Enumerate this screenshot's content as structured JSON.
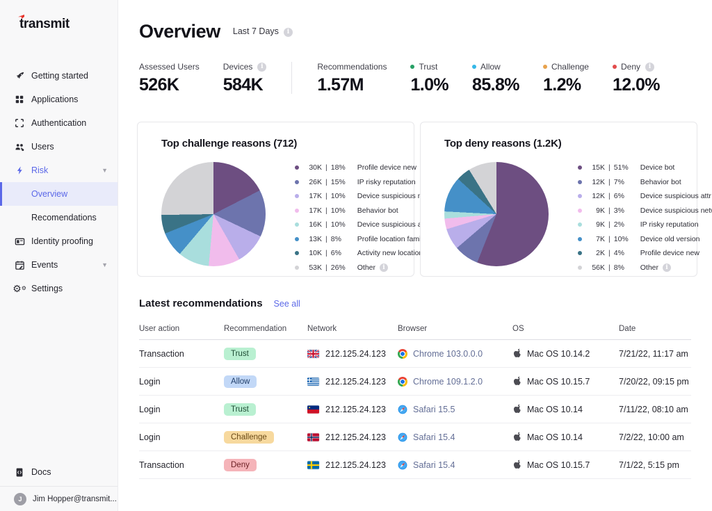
{
  "app": {
    "logo_text": "transmit"
  },
  "sidebar": {
    "items": [
      {
        "label": "Getting started",
        "icon": "rocket-icon"
      },
      {
        "label": "Applications",
        "icon": "grid-icon"
      },
      {
        "label": "Authentication",
        "icon": "frame-icon"
      },
      {
        "label": "Users",
        "icon": "users-icon"
      },
      {
        "label": "Risk",
        "icon": "bolt-icon",
        "active": true,
        "expandable": true
      },
      {
        "label": "Overview",
        "sub": true,
        "selected": true
      },
      {
        "label": "Recomendations",
        "sub": true
      },
      {
        "label": "Identity proofing",
        "icon": "id-card-icon"
      },
      {
        "label": "Events",
        "icon": "calendar-icon",
        "expandable": true
      },
      {
        "label": "Settings",
        "icon": "gears-icon"
      }
    ],
    "footer": {
      "docs_label": "Docs",
      "user_label": "Jim Hopper@transmit...",
      "avatar_initial": "J"
    }
  },
  "header": {
    "title": "Overview",
    "period": "Last 7 Days"
  },
  "stats": [
    {
      "label": "Assessed Users",
      "value": "526K"
    },
    {
      "label": "Devices",
      "value": "584K",
      "info": true
    },
    {
      "label": "Recommendations",
      "value": "1.57M",
      "divider_before": true
    },
    {
      "label": "Trust",
      "value": "1.0%",
      "dot": "#27a065"
    },
    {
      "label": "Allow",
      "value": "85.8%",
      "dot": "#35b8e8"
    },
    {
      "label": "Challenge",
      "value": "1.2%",
      "dot": "#e8a24c"
    },
    {
      "label": "Deny",
      "value": "12.0%",
      "dot": "#e24c4c",
      "info": true
    }
  ],
  "chart_data": [
    {
      "type": "pie",
      "title": "Top challenge reasons (712)",
      "slices": [
        {
          "value": "30K",
          "pct": 18,
          "label": "Profile device new",
          "color": "#6d4e81"
        },
        {
          "value": "26K",
          "pct": 15,
          "label": "IP risky reputation",
          "color": "#6d74ad"
        },
        {
          "value": "17K",
          "pct": 10,
          "label": "Device suspicious network",
          "color": "#b9aeea"
        },
        {
          "value": "17K",
          "pct": 10,
          "label": "Behavior bot",
          "color": "#f1bcec"
        },
        {
          "value": "16K",
          "pct": 10,
          "label": "Device suspicious attr",
          "color": "#a9dedd"
        },
        {
          "value": "13K",
          "pct": 8,
          "label": "Profile location familiar",
          "color": "#4590c8"
        },
        {
          "value": "10K",
          "pct": 6,
          "label": "Activity new location",
          "color": "#3a7386"
        },
        {
          "value": "53K",
          "pct": 26,
          "label": "Other",
          "color": "#d3d3d6",
          "info": true
        }
      ]
    },
    {
      "type": "pie",
      "title": "Top deny reasons (1.2K)",
      "slices": [
        {
          "value": "15K",
          "pct": 51,
          "label": "Device bot",
          "color": "#6d4e81"
        },
        {
          "value": "12K",
          "pct": 7,
          "label": "Behavior bot",
          "color": "#6d74ad"
        },
        {
          "value": "12K",
          "pct": 6,
          "label": "Device suspicious attr",
          "color": "#b9aeea"
        },
        {
          "value": "9K",
          "pct": 3,
          "label": "Device suspicious network",
          "color": "#f1bcec"
        },
        {
          "value": "9K",
          "pct": 2,
          "label": "IP risky reputation",
          "color": "#a9dedd"
        },
        {
          "value": "7K",
          "pct": 10,
          "label": "Device old version",
          "color": "#4590c8"
        },
        {
          "value": "2K",
          "pct": 4,
          "label": "Profile device new",
          "color": "#3a7386"
        },
        {
          "value": "56K",
          "pct": 8,
          "label": "Other",
          "color": "#d3d3d6",
          "info": true
        }
      ]
    }
  ],
  "recommendations": {
    "heading": "Latest recommendations",
    "see_all": "See all",
    "columns": [
      "User action",
      "Recommendation",
      "Network",
      "Browser",
      "OS",
      "Date"
    ],
    "rows": [
      {
        "action": "Transaction",
        "recommendation": "Trust",
        "flag": "uk",
        "network": "212.125.24.123",
        "browser_icon": "chrome",
        "browser": "Chrome 103.0.0.0",
        "os": "Mac OS 10.14.2",
        "date": "7/21/22, 11:17 am"
      },
      {
        "action": "Login",
        "recommendation": "Allow",
        "flag": "greece",
        "network": "212.125.24.123",
        "browser_icon": "chrome",
        "browser": "Chrome 109.1.2.0",
        "os": "Mac OS 10.15.7",
        "date": "7/20/22, 09:15 pm"
      },
      {
        "action": "Login",
        "recommendation": "Trust",
        "flag": "liechtenstein",
        "network": "212.125.24.123",
        "browser_icon": "safari",
        "browser": "Safari 15.5",
        "os": "Mac OS 10.14",
        "date": "7/11/22, 08:10 am"
      },
      {
        "action": "Login",
        "recommendation": "Challenge",
        "flag": "norway",
        "network": "212.125.24.123",
        "browser_icon": "safari",
        "browser": "Safari 15.4",
        "os": "Mac OS 10.14",
        "date": "7/2/22, 10:00 am"
      },
      {
        "action": "Transaction",
        "recommendation": "Deny",
        "flag": "sweden",
        "network": "212.125.24.123",
        "browser_icon": "safari",
        "browser": "Safari 15.4",
        "os": "Mac OS 10.15.7",
        "date": "7/1/22, 5:15 pm"
      }
    ],
    "badge_styles": {
      "Trust": {
        "bg": "#b9f0d1",
        "text": "#1e4d35"
      },
      "Allow": {
        "bg": "#c2d8f7",
        "text": "#23406b"
      },
      "Challenge": {
        "bg": "#f7d99e",
        "text": "#6b4a16"
      },
      "Deny": {
        "bg": "#f5b4b9",
        "text": "#6e2226"
      }
    }
  },
  "colors": {
    "accent": "#5b68e8",
    "logo_mark": "#e8352c"
  }
}
